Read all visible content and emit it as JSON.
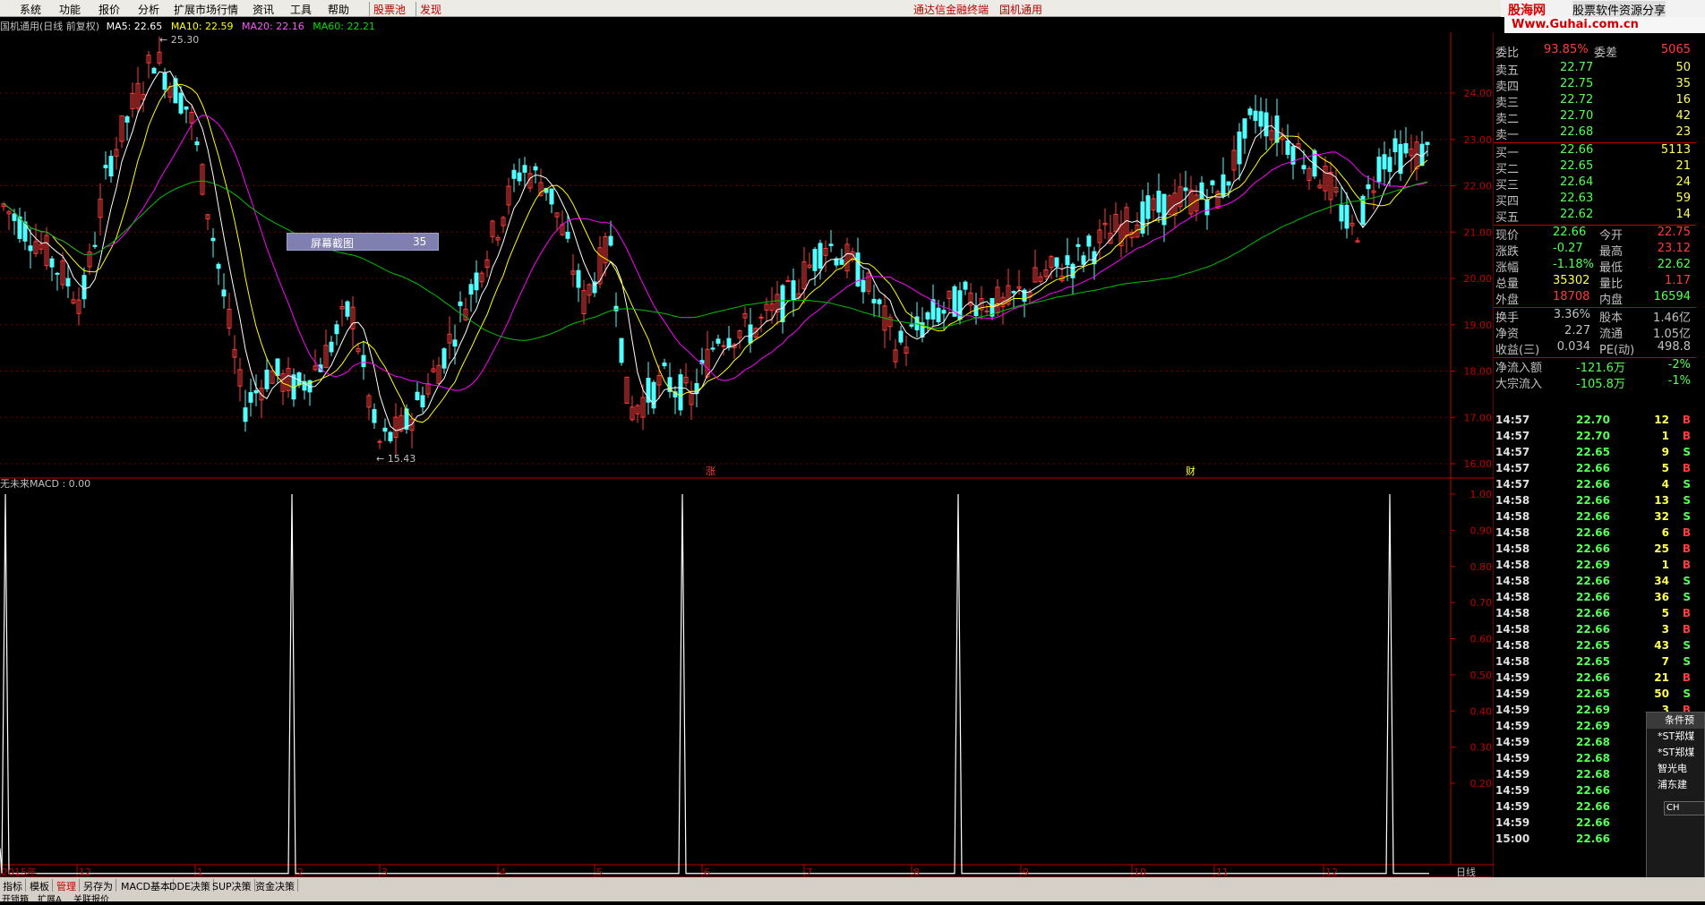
{
  "menu": {
    "items": [
      "系统",
      "功能",
      "报价",
      "分析",
      "扩展市场行情",
      "资讯",
      "工具",
      "帮助"
    ],
    "highlight_items": [
      "股票池",
      "发现"
    ],
    "center_links": [
      "通达信金融终端",
      "国机通用"
    ]
  },
  "brand": {
    "name": "股海网",
    "sub": "股票软件资源分享",
    "url": "Www.Guhai.com.cn"
  },
  "chart": {
    "title_stock": "国机通用(日线 前复权)",
    "ma5": "MA5: 22.65",
    "ma10": "MA10: 22.59",
    "ma20": "MA20: 22.16",
    "ma60": "MA60: 22.21",
    "high_label": "25.30",
    "low_label": "15.43",
    "price_ticks": [
      "24.00",
      "23.00",
      "22.00",
      "21.00",
      "20.00",
      "19.00",
      "18.00",
      "17.00",
      "16.00"
    ],
    "tooltip_label": "屏幕截图",
    "tooltip_value": "35",
    "markers": [
      "涨",
      "财"
    ],
    "colors": {
      "up": "#ff3c3c",
      "down": "#54ffff",
      "ma5": "#ffffff",
      "ma10": "#ffff00",
      "ma20": "#ff00ff",
      "ma60": "#00c000"
    }
  },
  "macd": {
    "title": "无未来MACD : 0.00",
    "ticks": [
      "1.00",
      "0.90",
      "0.80",
      "0.70",
      "0.60",
      "0.50",
      "0.40",
      "0.30",
      "0.20"
    ]
  },
  "xaxis": {
    "labels": [
      "2015年",
      "12",
      "1",
      "2",
      "3",
      "4",
      "5",
      "6",
      "7",
      "8",
      "9",
      "10",
      "11",
      "12"
    ],
    "period": "日线"
  },
  "quote": {
    "header": {
      "label": "委比",
      "value": "93.85%",
      "label2": "委差",
      "value2": "5065"
    },
    "asks": [
      {
        "label": "卖五",
        "price": "22.77",
        "vol": "50"
      },
      {
        "label": "卖四",
        "price": "22.75",
        "vol": "35"
      },
      {
        "label": "卖三",
        "price": "22.72",
        "vol": "16"
      },
      {
        "label": "卖二",
        "price": "22.70",
        "vol": "42"
      },
      {
        "label": "卖一",
        "price": "22.68",
        "vol": "23"
      }
    ],
    "bids": [
      {
        "label": "买一",
        "price": "22.66",
        "vol": "5113"
      },
      {
        "label": "买二",
        "price": "22.65",
        "vol": "21"
      },
      {
        "label": "买三",
        "price": "22.64",
        "vol": "24"
      },
      {
        "label": "买四",
        "price": "22.63",
        "vol": "59"
      },
      {
        "label": "买五",
        "price": "22.62",
        "vol": "14"
      }
    ],
    "stats": [
      {
        "l1": "现价",
        "v1": "22.66",
        "l2": "今开",
        "v2": "22.75",
        "c1": "#54ff54",
        "c2": "#ff3c3c"
      },
      {
        "l1": "涨跌",
        "v1": "-0.27",
        "l2": "最高",
        "v2": "23.12",
        "c1": "#54ff54",
        "c2": "#ff3c3c"
      },
      {
        "l1": "涨幅",
        "v1": "-1.18%",
        "l2": "最低",
        "v2": "22.62",
        "c1": "#54ff54",
        "c2": "#54ff54"
      },
      {
        "l1": "总量",
        "v1": "35302",
        "l2": "量比",
        "v2": "1.17",
        "c1": "#ffff54",
        "c2": "#ff3c3c"
      },
      {
        "l1": "外盘",
        "v1": "18708",
        "l2": "内盘",
        "v2": "16594",
        "c1": "#ff3c3c",
        "c2": "#54ff54"
      }
    ],
    "stats2": [
      {
        "l1": "换手",
        "v1": "3.36%",
        "l2": "股本",
        "v2": "1.46亿"
      },
      {
        "l1": "净资",
        "v1": "2.27",
        "l2": "流通",
        "v2": "1.05亿"
      },
      {
        "l1": "收益(三)",
        "v1": "0.034",
        "l2": "PE(动)",
        "v2": "498.8"
      }
    ],
    "flows": [
      {
        "label": "净流入额",
        "value": "-121.6万",
        "pct": "-2%"
      },
      {
        "label": "大宗流入",
        "value": "-105.8万",
        "pct": "-1%"
      }
    ]
  },
  "ticks": [
    {
      "t": "14:57",
      "p": "22.70",
      "v": "12",
      "s": "B"
    },
    {
      "t": "14:57",
      "p": "22.70",
      "v": "1",
      "s": "B"
    },
    {
      "t": "14:57",
      "p": "22.65",
      "v": "9",
      "s": "S"
    },
    {
      "t": "14:57",
      "p": "22.66",
      "v": "5",
      "s": "B"
    },
    {
      "t": "14:57",
      "p": "22.66",
      "v": "4",
      "s": "S"
    },
    {
      "t": "14:58",
      "p": "22.66",
      "v": "13",
      "s": "S"
    },
    {
      "t": "14:58",
      "p": "22.66",
      "v": "32",
      "s": "S"
    },
    {
      "t": "14:58",
      "p": "22.66",
      "v": "6",
      "s": "B"
    },
    {
      "t": "14:58",
      "p": "22.66",
      "v": "25",
      "s": "B"
    },
    {
      "t": "14:58",
      "p": "22.69",
      "v": "1",
      "s": "B"
    },
    {
      "t": "14:58",
      "p": "22.66",
      "v": "34",
      "s": "S"
    },
    {
      "t": "14:58",
      "p": "22.66",
      "v": "36",
      "s": "S"
    },
    {
      "t": "14:58",
      "p": "22.66",
      "v": "5",
      "s": "B"
    },
    {
      "t": "14:58",
      "p": "22.66",
      "v": "3",
      "s": "B"
    },
    {
      "t": "14:58",
      "p": "22.65",
      "v": "43",
      "s": "S"
    },
    {
      "t": "14:58",
      "p": "22.65",
      "v": "7",
      "s": "S"
    },
    {
      "t": "14:59",
      "p": "22.66",
      "v": "21",
      "s": "B"
    },
    {
      "t": "14:59",
      "p": "22.65",
      "v": "50",
      "s": "S"
    },
    {
      "t": "14:59",
      "p": "22.69",
      "v": "3",
      "s": "B"
    },
    {
      "t": "14:59",
      "p": "22.69",
      "v": "",
      "s": ""
    },
    {
      "t": "14:59",
      "p": "22.68",
      "v": "",
      "s": ""
    },
    {
      "t": "14:59",
      "p": "22.68",
      "v": "",
      "s": ""
    },
    {
      "t": "14:59",
      "p": "22.68",
      "v": "",
      "s": ""
    },
    {
      "t": "14:59",
      "p": "22.66",
      "v": "",
      "s": ""
    },
    {
      "t": "14:59",
      "p": "22.66",
      "v": "",
      "s": ""
    },
    {
      "t": "14:59",
      "p": "22.66",
      "v": "",
      "s": ""
    },
    {
      "t": "15:00",
      "p": "22.66",
      "v": "",
      "s": ""
    }
  ],
  "bottom_tabs": [
    "指标",
    "模板",
    "管理",
    "另存为",
    "MACD基本",
    "DDE决策",
    "SUP决策",
    "资金决策"
  ],
  "status_bar": [
    "开锁箱",
    "扩展A",
    "关联报价"
  ],
  "popup": {
    "title": "条件预",
    "items": [
      "*ST郑煤",
      "*ST郑煤",
      "智光电",
      "浦东建"
    ]
  },
  "ime": {
    "label": "CH"
  }
}
